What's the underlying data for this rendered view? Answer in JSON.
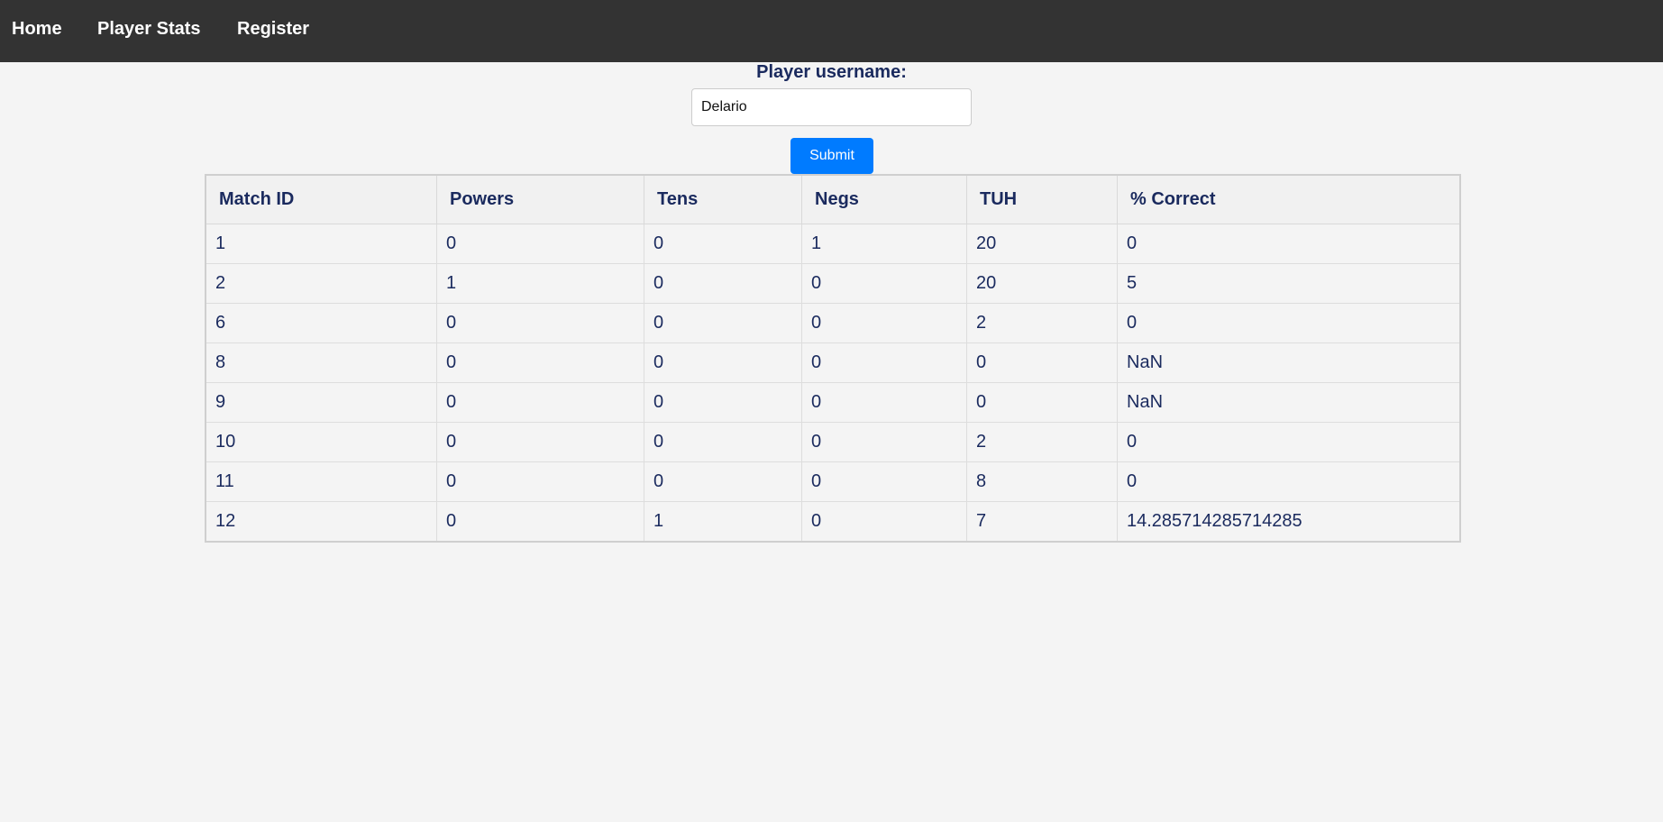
{
  "nav": {
    "home": "Home",
    "player_stats": "Player Stats",
    "register": "Register"
  },
  "form": {
    "label": "Player username:",
    "username_value": "Delario",
    "submit_label": "Submit"
  },
  "table": {
    "headers": [
      "Match ID",
      "Powers",
      "Tens",
      "Negs",
      "TUH",
      "% Correct"
    ],
    "rows": [
      [
        "1",
        "0",
        "0",
        "1",
        "20",
        "0"
      ],
      [
        "2",
        "1",
        "0",
        "0",
        "20",
        "5"
      ],
      [
        "6",
        "0",
        "0",
        "0",
        "2",
        "0"
      ],
      [
        "8",
        "0",
        "0",
        "0",
        "0",
        "NaN"
      ],
      [
        "9",
        "0",
        "0",
        "0",
        "0",
        "NaN"
      ],
      [
        "10",
        "0",
        "0",
        "0",
        "2",
        "0"
      ],
      [
        "11",
        "0",
        "0",
        "0",
        "8",
        "0"
      ],
      [
        "12",
        "0",
        "1",
        "0",
        "7",
        "14.285714285714285"
      ]
    ]
  },
  "colors": {
    "nav_bg": "#333333",
    "page_bg": "#f4f4f4",
    "accent": "#007bff",
    "text": "#1a2a5e"
  }
}
